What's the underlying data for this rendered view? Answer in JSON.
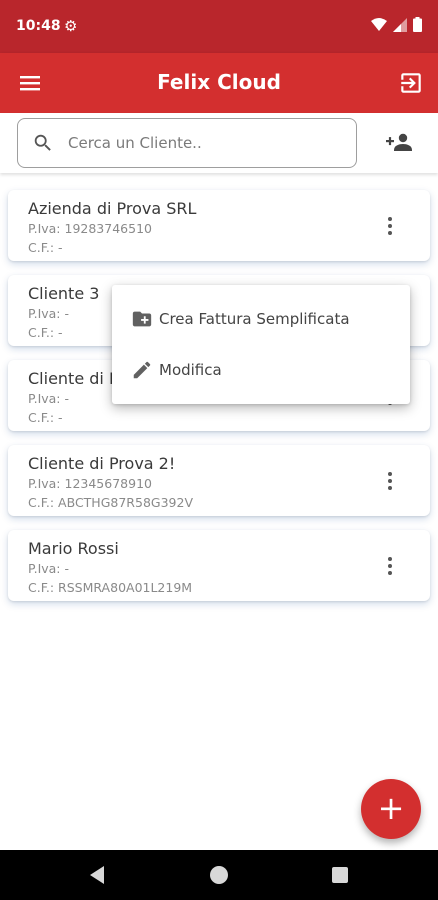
{
  "status_bar": {
    "time": "10:48"
  },
  "app_bar": {
    "title": "Felix Cloud"
  },
  "search": {
    "placeholder": "Cerca un Cliente..",
    "value": ""
  },
  "clients": [
    {
      "name": "Azienda di Prova SRL",
      "piva": "P.Iva: 19283746510",
      "cf": "C.F.: -"
    },
    {
      "name": "Cliente 3",
      "piva": "P.Iva: -",
      "cf": "C.F.: -"
    },
    {
      "name": "Cliente di P",
      "piva": "P.Iva: -",
      "cf": "C.F.: -"
    },
    {
      "name": "Cliente di Prova 2!",
      "piva": "P.Iva: 12345678910",
      "cf": "C.F.: ABCTHG87R58G392V"
    },
    {
      "name": "Mario Rossi",
      "piva": "P.Iva: -",
      "cf": "C.F.: RSSMRA80A01L219M"
    }
  ],
  "context_menu": {
    "items": [
      {
        "label": "Crea Fattura Semplificata",
        "icon": "create-new-folder-icon"
      },
      {
        "label": "Modifica",
        "icon": "pencil-icon"
      }
    ]
  },
  "fab": {
    "label": "+"
  },
  "colors": {
    "status_bar": "#b9262c",
    "primary": "#d32f2f"
  }
}
